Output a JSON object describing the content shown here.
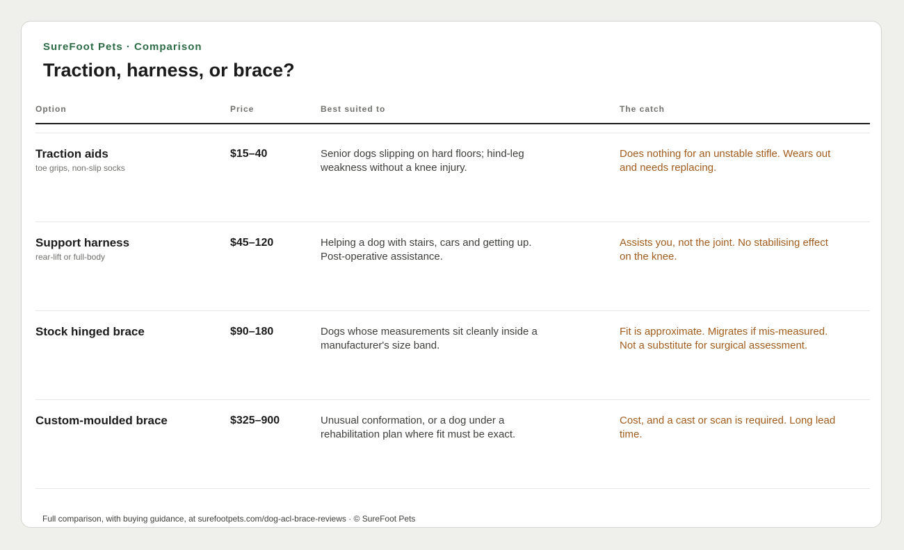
{
  "header": {
    "brand": "SureFoot Pets · Comparison",
    "title": "Traction, harness, or brace?"
  },
  "table": {
    "columns": [
      "Option",
      "Price",
      "Best suited to",
      "The catch"
    ],
    "rows": [
      {
        "option": "Traction aids",
        "subtitle": "toe grips, non-slip socks",
        "price": "$15–40",
        "best_suited": "Senior dogs slipping on hard floors; hind-leg weakness without a knee injury.",
        "catch": "Does nothing for an unstable stifle. Wears out and needs replacing."
      },
      {
        "option": "Support harness",
        "subtitle": "rear-lift or full-body",
        "price": "$45–120",
        "best_suited": "Helping a dog with stairs, cars and getting up. Post-operative assistance.",
        "catch": "Assists you, not the joint. No stabilising effect on the knee."
      },
      {
        "option": "Stock hinged brace",
        "subtitle": "",
        "price": "$90–180",
        "best_suited": "Dogs whose measurements sit cleanly inside a manufacturer's size band.",
        "catch": "Fit is approximate. Migrates if mis-measured. Not a substitute for surgical assessment."
      },
      {
        "option": "Custom-moulded brace",
        "subtitle": "",
        "price": "$325–900",
        "best_suited": "Unusual conformation, or a dog under a rehabilitation plan where fit must be exact.",
        "catch": "Cost, and a cast or scan is required. Long lead time."
      }
    ]
  },
  "footer": {
    "text": "Full comparison, with buying guidance, at surefootpets.com/dog-acl-brace-reviews · © SureFoot Pets"
  },
  "colors": {
    "brand": "#2c6b45",
    "catch_text": "#a15b1c",
    "background": "#eff0eb"
  }
}
